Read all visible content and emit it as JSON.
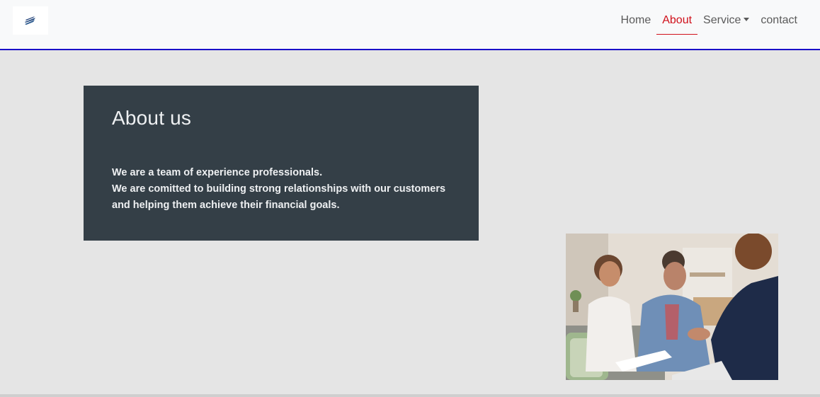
{
  "nav": {
    "items": [
      {
        "label": "Home",
        "active": false,
        "dropdown": false
      },
      {
        "label": "About",
        "active": true,
        "dropdown": false
      },
      {
        "label": "Service",
        "active": false,
        "dropdown": true
      },
      {
        "label": "contact",
        "active": false,
        "dropdown": false
      }
    ]
  },
  "about": {
    "title": "About us",
    "lines": [
      "We are a team of experience professionals.",
      "We are comitted to building strong relationships with our customers",
      "and helping them achieve their financial goals."
    ]
  },
  "colors": {
    "accent": "#d0101a",
    "nav_border": "#1a10c8",
    "panel_bg": "#343f47",
    "page_bg": "#e5e5e5"
  },
  "icons": {
    "logo": "brand-logo-icon",
    "dropdown": "caret-down-icon"
  }
}
